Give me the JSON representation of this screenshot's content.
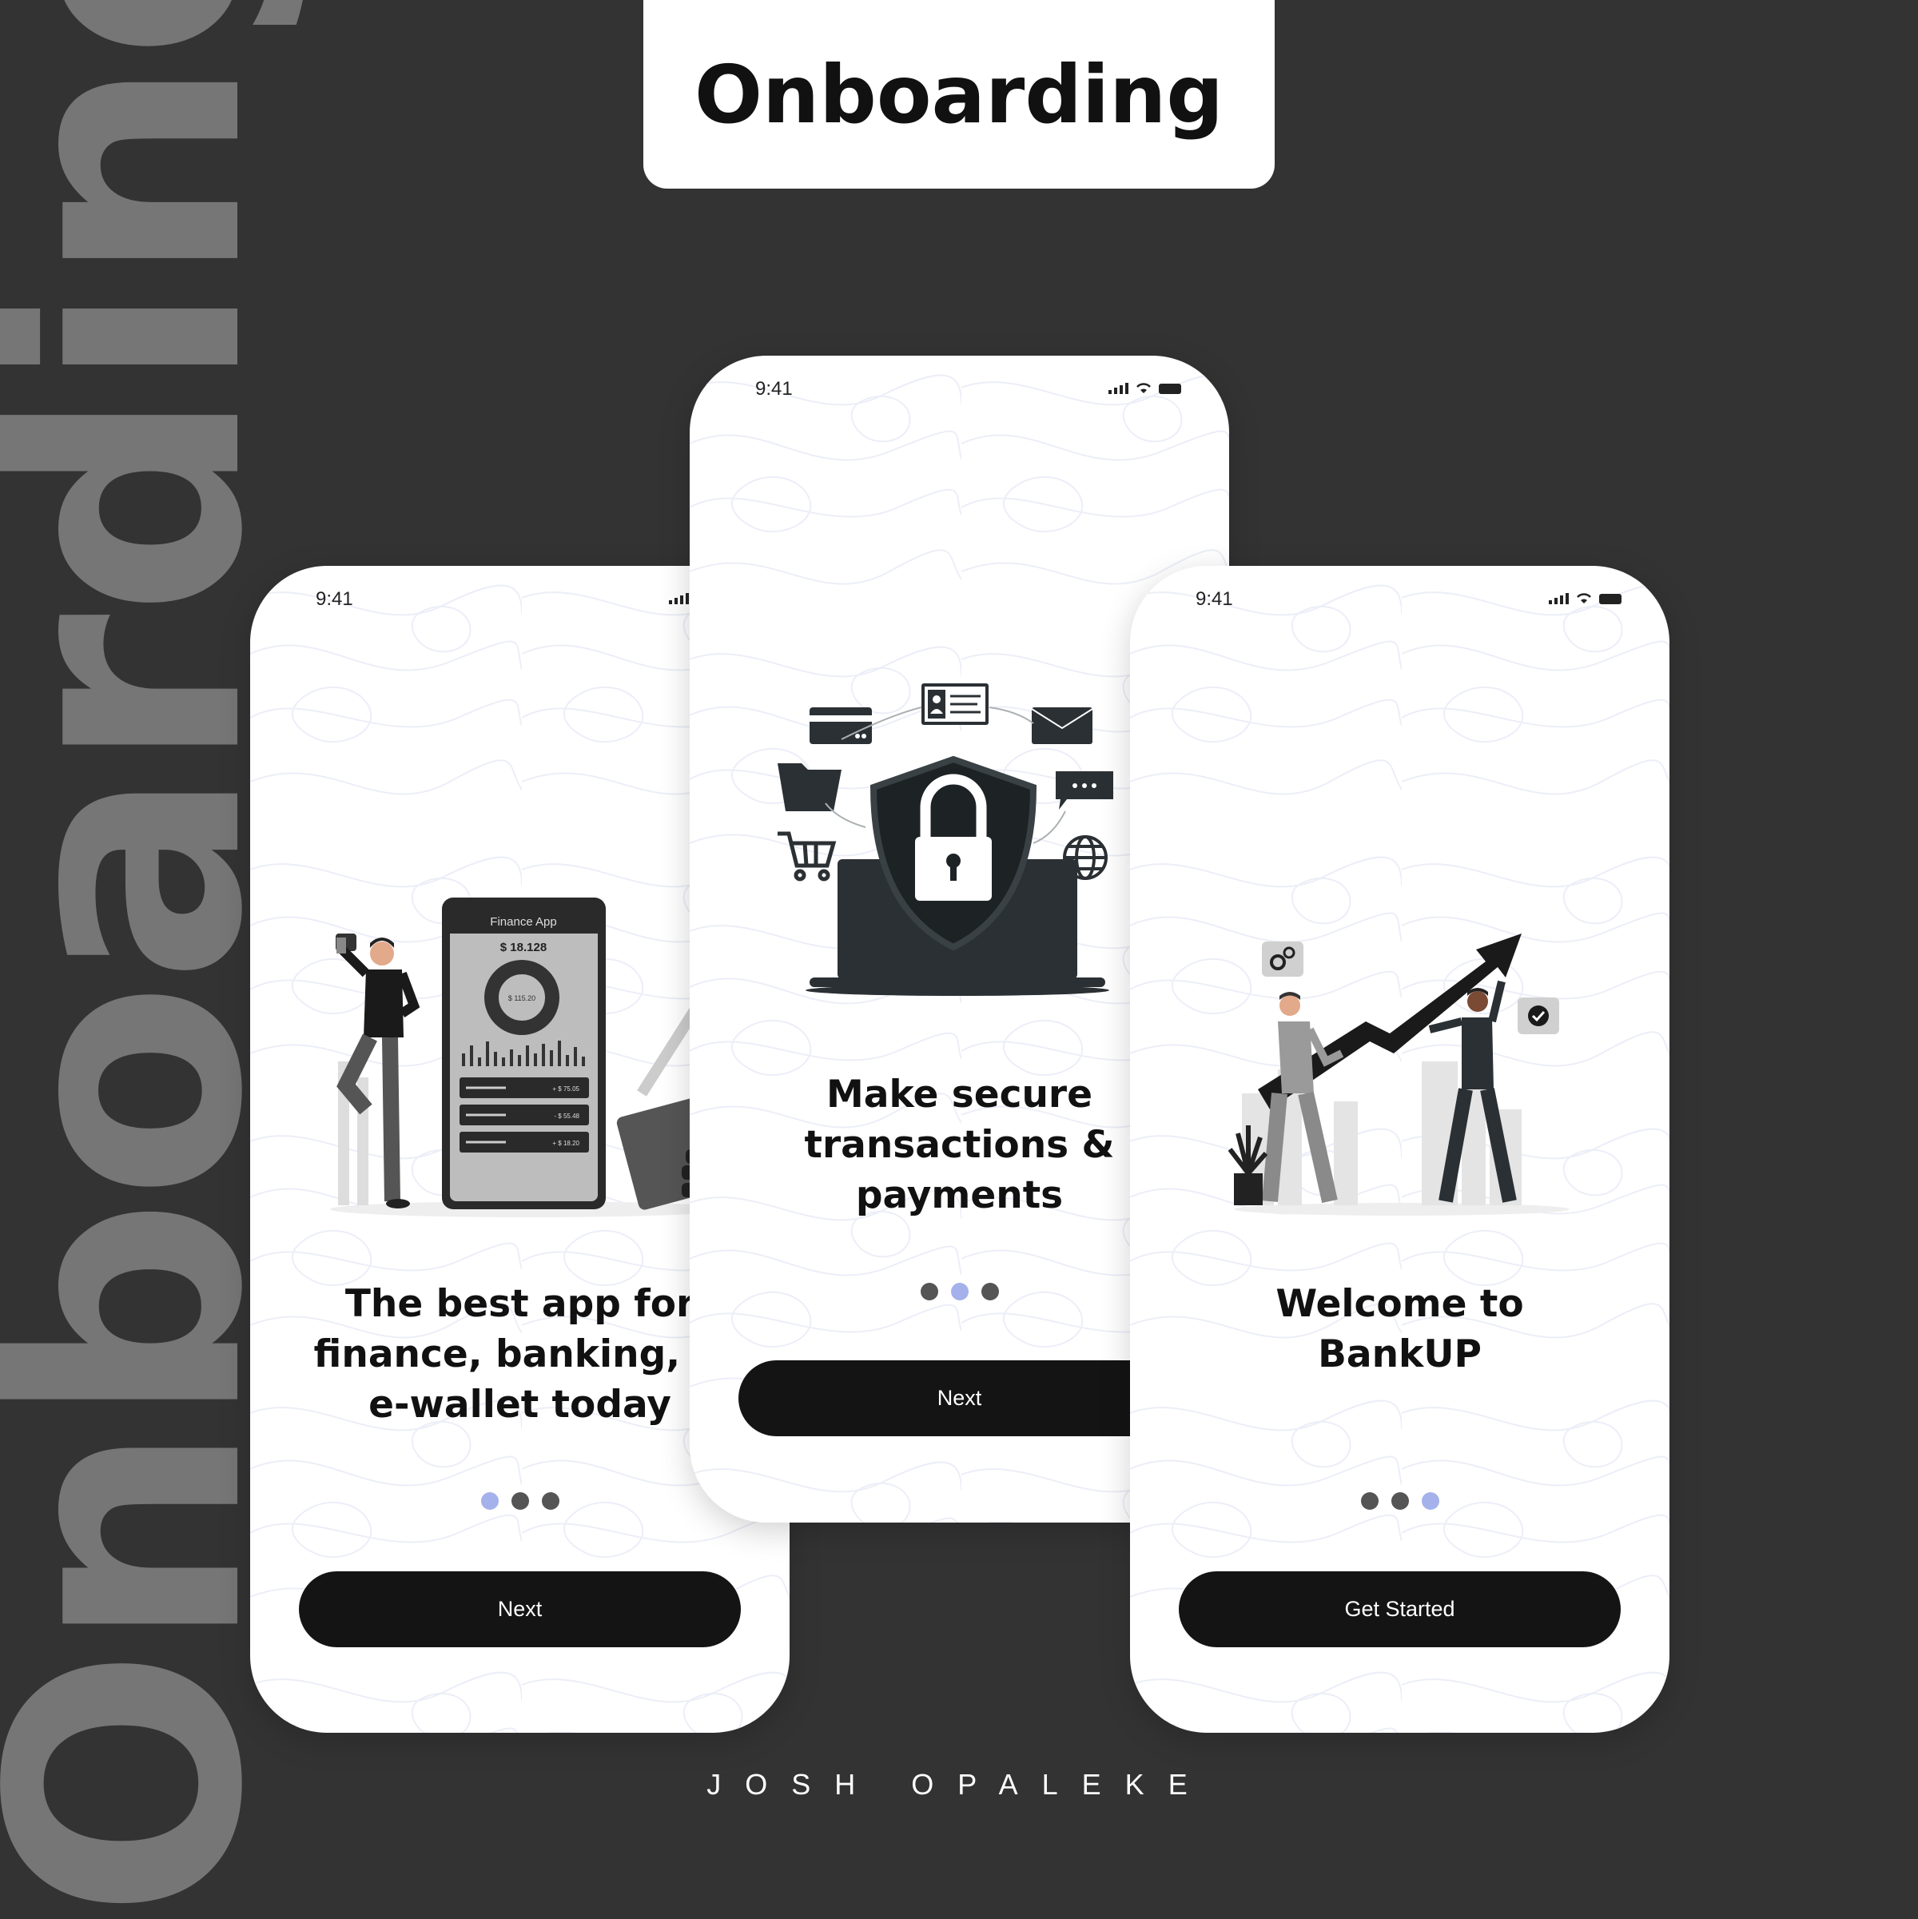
{
  "background_word": "Onboarding",
  "title": "Onboarding",
  "colors": {
    "background": "#333333",
    "accent": "#a5b1ea",
    "button": "#141414",
    "dot": "#555555"
  },
  "screens": [
    {
      "time": "9:41",
      "headline_lines": [
        "The best app for",
        "finance, banking, &",
        "e-wallet today"
      ],
      "button": "Next",
      "active_dot": 0,
      "illustration": {
        "app_title": "Finance App",
        "balance": "$ 18.128",
        "donut_value": "$ 115.20",
        "rows": [
          "+ $ 75.05",
          "- $ 55.48",
          "+ $ 18.20"
        ]
      }
    },
    {
      "time": "9:41",
      "headline_lines": [
        "Make secure",
        "transactions &",
        "payments"
      ],
      "button": "Next",
      "active_dot": 1,
      "illustration": {
        "icons": [
          "card-icon",
          "id-card-icon",
          "mail-icon",
          "folder-icon",
          "chat-icon",
          "cart-icon",
          "globe-icon",
          "lock-icon",
          "laptop-icon"
        ]
      }
    },
    {
      "time": "9:41",
      "headline_lines": [
        "Welcome to",
        "BankUP"
      ],
      "button": "Get Started",
      "active_dot": 2,
      "illustration": {
        "icons": [
          "gear-icon",
          "check-icon",
          "growth-arrow",
          "plant-icon"
        ]
      }
    }
  ],
  "author": "JOSH OPALEKE"
}
